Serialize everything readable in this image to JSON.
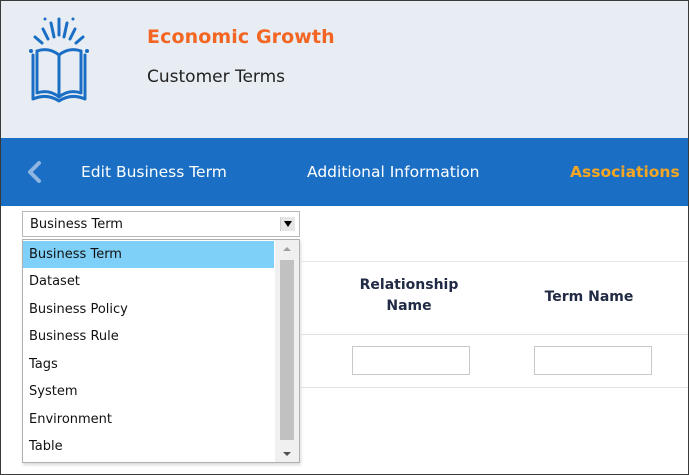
{
  "header": {
    "app_title": "Economic Growth",
    "page_subtitle": "Customer Terms",
    "logo_icon": "open-book-icon",
    "background_color": "#e8edf3",
    "title_color": "#f26522"
  },
  "nav": {
    "background_color": "#1a6fc4",
    "back_icon": "chevron-left-icon",
    "tabs": [
      {
        "label": "Edit Business Term",
        "active": false
      },
      {
        "label": "Additional Information",
        "active": false
      },
      {
        "label": "Associations",
        "active": true
      }
    ],
    "active_color": "#f5a623"
  },
  "type_select": {
    "value": "Business Term",
    "expanded": true,
    "options": [
      "Business Term",
      "Dataset",
      "Business Policy",
      "Business Rule",
      "Tags",
      "System",
      "Environment",
      "Table"
    ],
    "highlight_color": "#7fd0f8"
  },
  "table": {
    "columns": [
      "Relationship Name",
      "Term Name"
    ],
    "filters": {
      "relationship_name": "",
      "term_name": ""
    }
  }
}
